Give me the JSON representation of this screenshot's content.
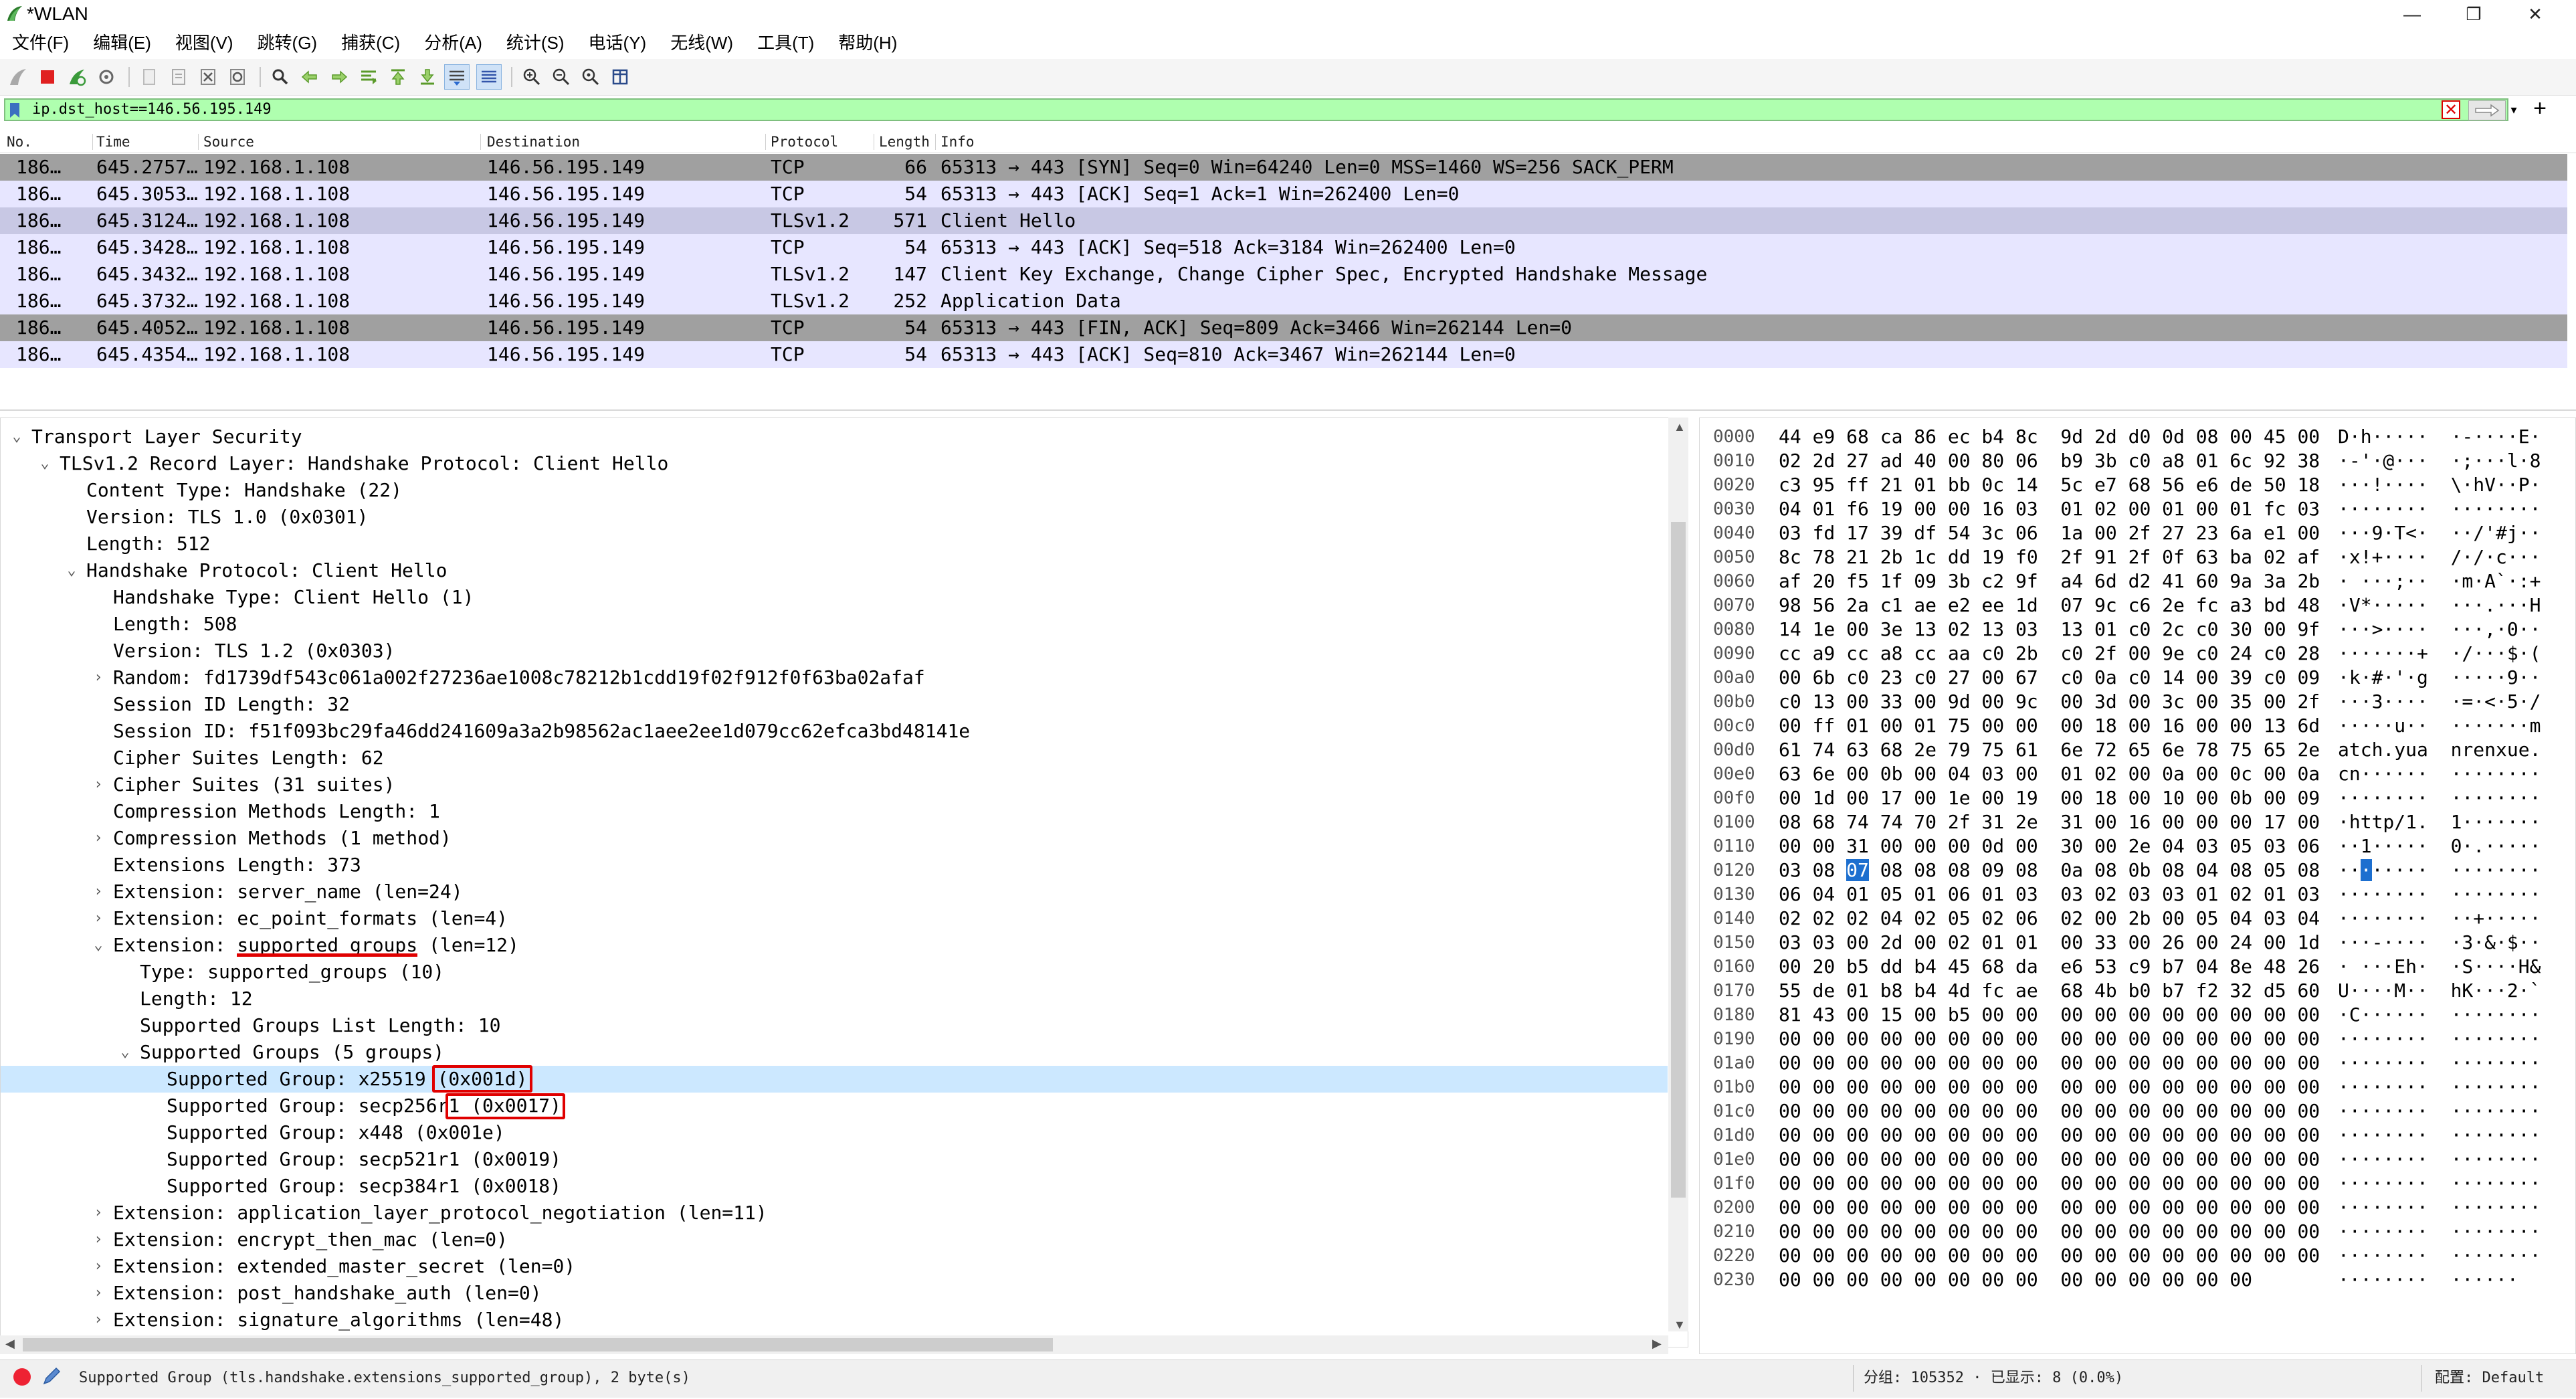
{
  "window": {
    "title": "*WLAN",
    "minimize": "—",
    "maximize": "❐",
    "close": "✕"
  },
  "menu": [
    "文件(F)",
    "编辑(E)",
    "视图(V)",
    "跳转(G)",
    "捕获(C)",
    "分析(A)",
    "统计(S)",
    "电话(Y)",
    "无线(W)",
    "工具(T)",
    "帮助(H)"
  ],
  "filter": {
    "value": "ip.dst_host==146.56.195.149",
    "clear_glyph": "✕",
    "add_glyph": "+"
  },
  "packet_list": {
    "columns": [
      "No.",
      "Time",
      "Source",
      "Destination",
      "Protocol",
      "Length",
      "Info"
    ],
    "rows": [
      {
        "no": "186…",
        "time": "645.2757…",
        "src": "192.168.1.108",
        "dst": "146.56.195.149",
        "proto": "TCP",
        "len": "66",
        "info": "65313 → 443 [SYN] Seq=0 Win=64240 Len=0 MSS=1460 WS=256 SACK_PERM",
        "bg": "#a0a0a0"
      },
      {
        "no": "186…",
        "time": "645.3053…",
        "src": "192.168.1.108",
        "dst": "146.56.195.149",
        "proto": "TCP",
        "len": "54",
        "info": "65313 → 443 [ACK] Seq=1 Ack=1 Win=262400 Len=0",
        "bg": "#e7e6ff"
      },
      {
        "no": "186…",
        "time": "645.3124…",
        "src": "192.168.1.108",
        "dst": "146.56.195.149",
        "proto": "TLSv1.2",
        "len": "571",
        "info": "Client Hello",
        "bg": "#c8c8e4"
      },
      {
        "no": "186…",
        "time": "645.3428…",
        "src": "192.168.1.108",
        "dst": "146.56.195.149",
        "proto": "TCP",
        "len": "54",
        "info": "65313 → 443 [ACK] Seq=518 Ack=3184 Win=262400 Len=0",
        "bg": "#e7e6ff"
      },
      {
        "no": "186…",
        "time": "645.3432…",
        "src": "192.168.1.108",
        "dst": "146.56.195.149",
        "proto": "TLSv1.2",
        "len": "147",
        "info": "Client Key Exchange, Change Cipher Spec, Encrypted Handshake Message",
        "bg": "#e7e6ff"
      },
      {
        "no": "186…",
        "time": "645.3732…",
        "src": "192.168.1.108",
        "dst": "146.56.195.149",
        "proto": "TLSv1.2",
        "len": "252",
        "info": "Application Data",
        "bg": "#e7e6ff"
      },
      {
        "no": "186…",
        "time": "645.4052…",
        "src": "192.168.1.108",
        "dst": "146.56.195.149",
        "proto": "TCP",
        "len": "54",
        "info": "65313 → 443 [FIN, ACK] Seq=809 Ack=3466 Win=262144 Len=0",
        "bg": "#a0a0a0"
      },
      {
        "no": "186…",
        "time": "645.4354…",
        "src": "192.168.1.108",
        "dst": "146.56.195.149",
        "proto": "TCP",
        "len": "54",
        "info": "65313 → 443 [ACK] Seq=810 Ack=3467 Win=262144 Len=0",
        "bg": "#e7e6ff"
      }
    ]
  },
  "details": [
    {
      "level": 0,
      "toggle": "⌄",
      "text": "Transport Layer Security"
    },
    {
      "level": 1,
      "toggle": "⌄",
      "text": "TLSv1.2 Record Layer: Handshake Protocol: Client Hello"
    },
    {
      "level": 2,
      "toggle": "",
      "text": "Content Type: Handshake (22)"
    },
    {
      "level": 2,
      "toggle": "",
      "text": "Version: TLS 1.0 (0x0301)"
    },
    {
      "level": 2,
      "toggle": "",
      "text": "Length: 512"
    },
    {
      "level": 2,
      "toggle": "⌄",
      "text": "Handshake Protocol: Client Hello"
    },
    {
      "level": 3,
      "toggle": "",
      "text": "Handshake Type: Client Hello (1)"
    },
    {
      "level": 3,
      "toggle": "",
      "text": "Length: 508"
    },
    {
      "level": 3,
      "toggle": "",
      "text": "Version: TLS 1.2 (0x0303)"
    },
    {
      "level": 3,
      "toggle": "›",
      "text": "Random: fd1739df543c061a002f27236ae1008c78212b1cdd19f02f912f0f63ba02afaf"
    },
    {
      "level": 3,
      "toggle": "",
      "text": "Session ID Length: 32"
    },
    {
      "level": 3,
      "toggle": "",
      "text": "Session ID: f51f093bc29fa46dd241609a3a2b98562ac1aee2ee1d079cc62efca3bd48141e"
    },
    {
      "level": 3,
      "toggle": "",
      "text": "Cipher Suites Length: 62"
    },
    {
      "level": 3,
      "toggle": "›",
      "text": "Cipher Suites (31 suites)"
    },
    {
      "level": 3,
      "toggle": "",
      "text": "Compression Methods Length: 1"
    },
    {
      "level": 3,
      "toggle": "›",
      "text": "Compression Methods (1 method)"
    },
    {
      "level": 3,
      "toggle": "",
      "text": "Extensions Length: 373"
    },
    {
      "level": 3,
      "toggle": "›",
      "text": "Extension: server_name (len=24)"
    },
    {
      "level": 3,
      "toggle": "›",
      "text": "Extension: ec_point_formats (len=4)"
    },
    {
      "level": 3,
      "toggle": "⌄",
      "text": "Extension: supported_groups (len=12)"
    },
    {
      "level": 4,
      "toggle": "",
      "text": "Type: supported_groups (10)"
    },
    {
      "level": 4,
      "toggle": "",
      "text": "Length: 12"
    },
    {
      "level": 4,
      "toggle": "",
      "text": "Supported Groups List Length: 10"
    },
    {
      "level": 4,
      "toggle": "⌄",
      "text": "Supported Groups (5 groups)"
    },
    {
      "level": 5,
      "toggle": "",
      "text": "Supported Group: x25519 (0x001d)",
      "selected": true
    },
    {
      "level": 5,
      "toggle": "",
      "text": "Supported Group: secp256r1 (0x0017)"
    },
    {
      "level": 5,
      "toggle": "",
      "text": "Supported Group: x448 (0x001e)"
    },
    {
      "level": 5,
      "toggle": "",
      "text": "Supported Group: secp521r1 (0x0019)"
    },
    {
      "level": 5,
      "toggle": "",
      "text": "Supported Group: secp384r1 (0x0018)"
    },
    {
      "level": 3,
      "toggle": "›",
      "text": "Extension: application_layer_protocol_negotiation (len=11)"
    },
    {
      "level": 3,
      "toggle": "›",
      "text": "Extension: encrypt_then_mac (len=0)"
    },
    {
      "level": 3,
      "toggle": "›",
      "text": "Extension: extended_master_secret (len=0)"
    },
    {
      "level": 3,
      "toggle": "›",
      "text": "Extension: post_handshake_auth (len=0)"
    },
    {
      "level": 3,
      "toggle": "›",
      "text": "Extension: signature_algorithms (len=48)"
    }
  ],
  "hex": [
    {
      "off": "0000",
      "bytes": "44 e9 68 ca 86 ec b4 8c  9d 2d d0 0d 08 00 45 00",
      "ascii": "D·h·····  ·-····E·"
    },
    {
      "off": "0010",
      "bytes": "02 2d 27 ad 40 00 80 06  b9 3b c0 a8 01 6c 92 38",
      "ascii": "·-'·@···  ·;···l·8"
    },
    {
      "off": "0020",
      "bytes": "c3 95 ff 21 01 bb 0c 14  5c e7 68 56 e6 de 50 18",
      "ascii": "···!····  \\·hV··P·"
    },
    {
      "off": "0030",
      "bytes": "04 01 f6 19 00 00 16 03  01 02 00 01 00 01 fc 03",
      "ascii": "········  ········"
    },
    {
      "off": "0040",
      "bytes": "03 fd 17 39 df 54 3c 06  1a 00 2f 27 23 6a e1 00",
      "ascii": "···9·T<·  ··/'#j··"
    },
    {
      "off": "0050",
      "bytes": "8c 78 21 2b 1c dd 19 f0  2f 91 2f 0f 63 ba 02 af",
      "ascii": "·x!+····  /·/·c···"
    },
    {
      "off": "0060",
      "bytes": "af 20 f5 1f 09 3b c2 9f  a4 6d d2 41 60 9a 3a 2b",
      "ascii": "· ···;··  ·m·A`·:+"
    },
    {
      "off": "0070",
      "bytes": "98 56 2a c1 ae e2 ee 1d  07 9c c6 2e fc a3 bd 48",
      "ascii": "·V*·····  ···.···H"
    },
    {
      "off": "0080",
      "bytes": "14 1e 00 3e 13 02 13 03  13 01 c0 2c c0 30 00 9f",
      "ascii": "···>····  ···,·0··"
    },
    {
      "off": "0090",
      "bytes": "cc a9 cc a8 cc aa c0 2b  c0 2f 00 9e c0 24 c0 28",
      "ascii": "·······+  ·/···$·("
    },
    {
      "off": "00a0",
      "bytes": "00 6b c0 23 c0 27 00 67  c0 0a c0 14 00 39 c0 09",
      "ascii": "·k·#·'·g  ·····9··"
    },
    {
      "off": "00b0",
      "bytes": "c0 13 00 33 00 9d 00 9c  00 3d 00 3c 00 35 00 2f",
      "ascii": "···3····  ·=·<·5·/"
    },
    {
      "off": "00c0",
      "bytes": "00 ff 01 00 01 75 00 00  00 18 00 16 00 00 13 6d",
      "ascii": "·····u··  ·······m"
    },
    {
      "off": "00d0",
      "bytes": "61 74 63 68 2e 79 75 61  6e 72 65 6e 78 75 65 2e",
      "ascii": "atch.yua  nrenxue."
    },
    {
      "off": "00e0",
      "bytes": "63 6e 00 0b 00 04 03 00  01 02 00 0a 00 0c 00 0a",
      "ascii": "cn······  ········"
    },
    {
      "off": "00f0",
      "bytes": "00 1d 00 17 00 1e 00 19  00 18 00 10 00 0b 00 09",
      "ascii": "········  ········"
    },
    {
      "off": "0100",
      "bytes": "08 68 74 74 70 2f 31 2e  31 00 16 00 00 00 17 00",
      "ascii": "·http/1.  1·······"
    },
    {
      "off": "0110",
      "bytes": "00 00 31 00 00 00 0d 00  30 00 2e 04 03 05 03 06",
      "ascii": "··1·····  0·.·····"
    },
    {
      "off": "0120",
      "bytes": "03 08 07 08 08 08 09 08  0a 08 0b 08 04 08 05 08",
      "ascii": "········  ········"
    },
    {
      "off": "0130",
      "bytes": "06 04 01 05 01 06 01 03  03 02 03 03 01 02 01 03",
      "ascii": "········  ········"
    },
    {
      "off": "0140",
      "bytes": "02 02 02 04 02 05 02 06  02 00 2b 00 05 04 03 04",
      "ascii": "········  ··+·····"
    },
    {
      "off": "0150",
      "bytes": "03 03 00 2d 00 02 01 01  00 33 00 26 00 24 00 1d",
      "ascii": "···-····  ·3·&·$··"
    },
    {
      "off": "0160",
      "bytes": "00 20 b5 dd b4 45 68 da  e6 53 c9 b7 04 8e 48 26",
      "ascii": "· ···Eh·  ·S····H&"
    },
    {
      "off": "0170",
      "bytes": "55 de 01 b8 b4 4d fc ae  68 4b b0 b7 f2 32 d5 60",
      "ascii": "U····M··  hK···2·`"
    },
    {
      "off": "0180",
      "bytes": "81 43 00 15 00 b5 00 00  00 00 00 00 00 00 00 00",
      "ascii": "·C······  ········"
    },
    {
      "off": "0190",
      "bytes": "00 00 00 00 00 00 00 00  00 00 00 00 00 00 00 00",
      "ascii": "········  ········"
    },
    {
      "off": "01a0",
      "bytes": "00 00 00 00 00 00 00 00  00 00 00 00 00 00 00 00",
      "ascii": "········  ········"
    },
    {
      "off": "01b0",
      "bytes": "00 00 00 00 00 00 00 00  00 00 00 00 00 00 00 00",
      "ascii": "········  ········"
    },
    {
      "off": "01c0",
      "bytes": "00 00 00 00 00 00 00 00  00 00 00 00 00 00 00 00",
      "ascii": "········  ········"
    },
    {
      "off": "01d0",
      "bytes": "00 00 00 00 00 00 00 00  00 00 00 00 00 00 00 00",
      "ascii": "········  ········"
    },
    {
      "off": "01e0",
      "bytes": "00 00 00 00 00 00 00 00  00 00 00 00 00 00 00 00",
      "ascii": "········  ········"
    },
    {
      "off": "01f0",
      "bytes": "00 00 00 00 00 00 00 00  00 00 00 00 00 00 00 00",
      "ascii": "········  ········"
    },
    {
      "off": "0200",
      "bytes": "00 00 00 00 00 00 00 00  00 00 00 00 00 00 00 00",
      "ascii": "········  ········"
    },
    {
      "off": "0210",
      "bytes": "00 00 00 00 00 00 00 00  00 00 00 00 00 00 00 00",
      "ascii": "········  ········"
    },
    {
      "off": "0220",
      "bytes": "00 00 00 00 00 00 00 00  00 00 00 00 00 00 00 00",
      "ascii": "········  ········"
    },
    {
      "off": "0230",
      "bytes": "00 00 00 00 00 00 00 00  00 00 00 00 00 00",
      "ascii": "········  ······"
    }
  ],
  "status": {
    "field": "Supported Group (tls.handshake.extensions_supported_group), 2 byte(s)",
    "count": "分组: 105352 · 已显示: 8 (0.0%)",
    "profile": "配置: Default"
  },
  "colors": {
    "tcp_row": "#e7e6ff",
    "tls_selected_row": "#c8c8e4",
    "flag_row": "#a0a0a0",
    "filter_ok": "#afffaf",
    "annotation": "#e00000"
  }
}
